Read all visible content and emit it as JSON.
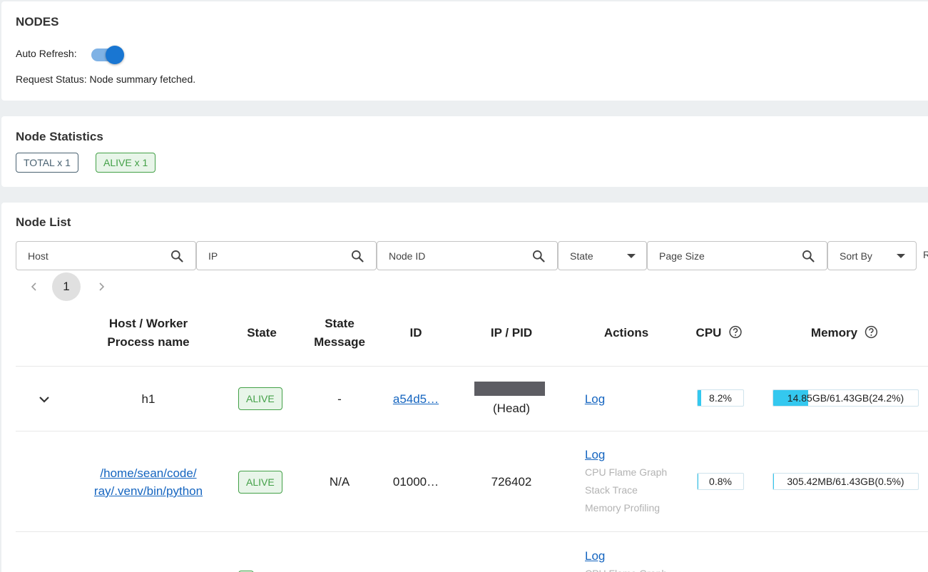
{
  "header": {
    "title": "NODES",
    "auto_refresh_label": "Auto Refresh:",
    "request_status": "Request Status: Node summary fetched."
  },
  "statistics": {
    "title": "Node Statistics",
    "total_chip": "TOTAL x 1",
    "alive_chip": "ALIVE x 1"
  },
  "node_list": {
    "title": "Node List",
    "filters": {
      "host": "Host",
      "ip": "IP",
      "node_id": "Node ID",
      "state": "State",
      "page_size": "Page Size",
      "sort_by": "Sort By",
      "truncated": "R"
    },
    "pagination": {
      "current_page": "1"
    },
    "columns": {
      "host_line1": "Host / Worker",
      "host_line2": "Process name",
      "state": "State",
      "state_msg_line1": "State",
      "state_msg_line2": "Message",
      "id": "ID",
      "ip_pid": "IP / PID",
      "actions": "Actions",
      "cpu": "CPU",
      "memory": "Memory"
    },
    "rows": [
      {
        "host": "h1",
        "state": "ALIVE",
        "state_message": "-",
        "id": "a54d5…",
        "ip_suffix": "(Head)",
        "action_log": "Log",
        "cpu": "8.2%",
        "cpu_fraction": 0.082,
        "memory": "14.85GB/61.43GB(24.2%)",
        "memory_fraction": 0.242
      },
      {
        "host_line1": "/home/sean/code/",
        "host_line2": "ray/.venv/bin/python",
        "state": "ALIVE",
        "state_message": "N/A",
        "id": "01000…",
        "pid": "726402",
        "action_log": "Log",
        "action_cpu_flame": "CPU Flame Graph",
        "action_stack": "Stack Trace",
        "action_memory": "Memory Profiling",
        "cpu": "0.8%",
        "cpu_fraction": 0.008,
        "memory": "305.42MB/61.43GB(0.5%)",
        "memory_fraction": 0.005
      },
      {
        "action_log": "Log",
        "action_cpu_flame": "CPU Flame Graph"
      }
    ]
  },
  "colors": {
    "primary": "#1976d2",
    "alive": "#43a047",
    "bar_fill": "#34c8ef"
  }
}
